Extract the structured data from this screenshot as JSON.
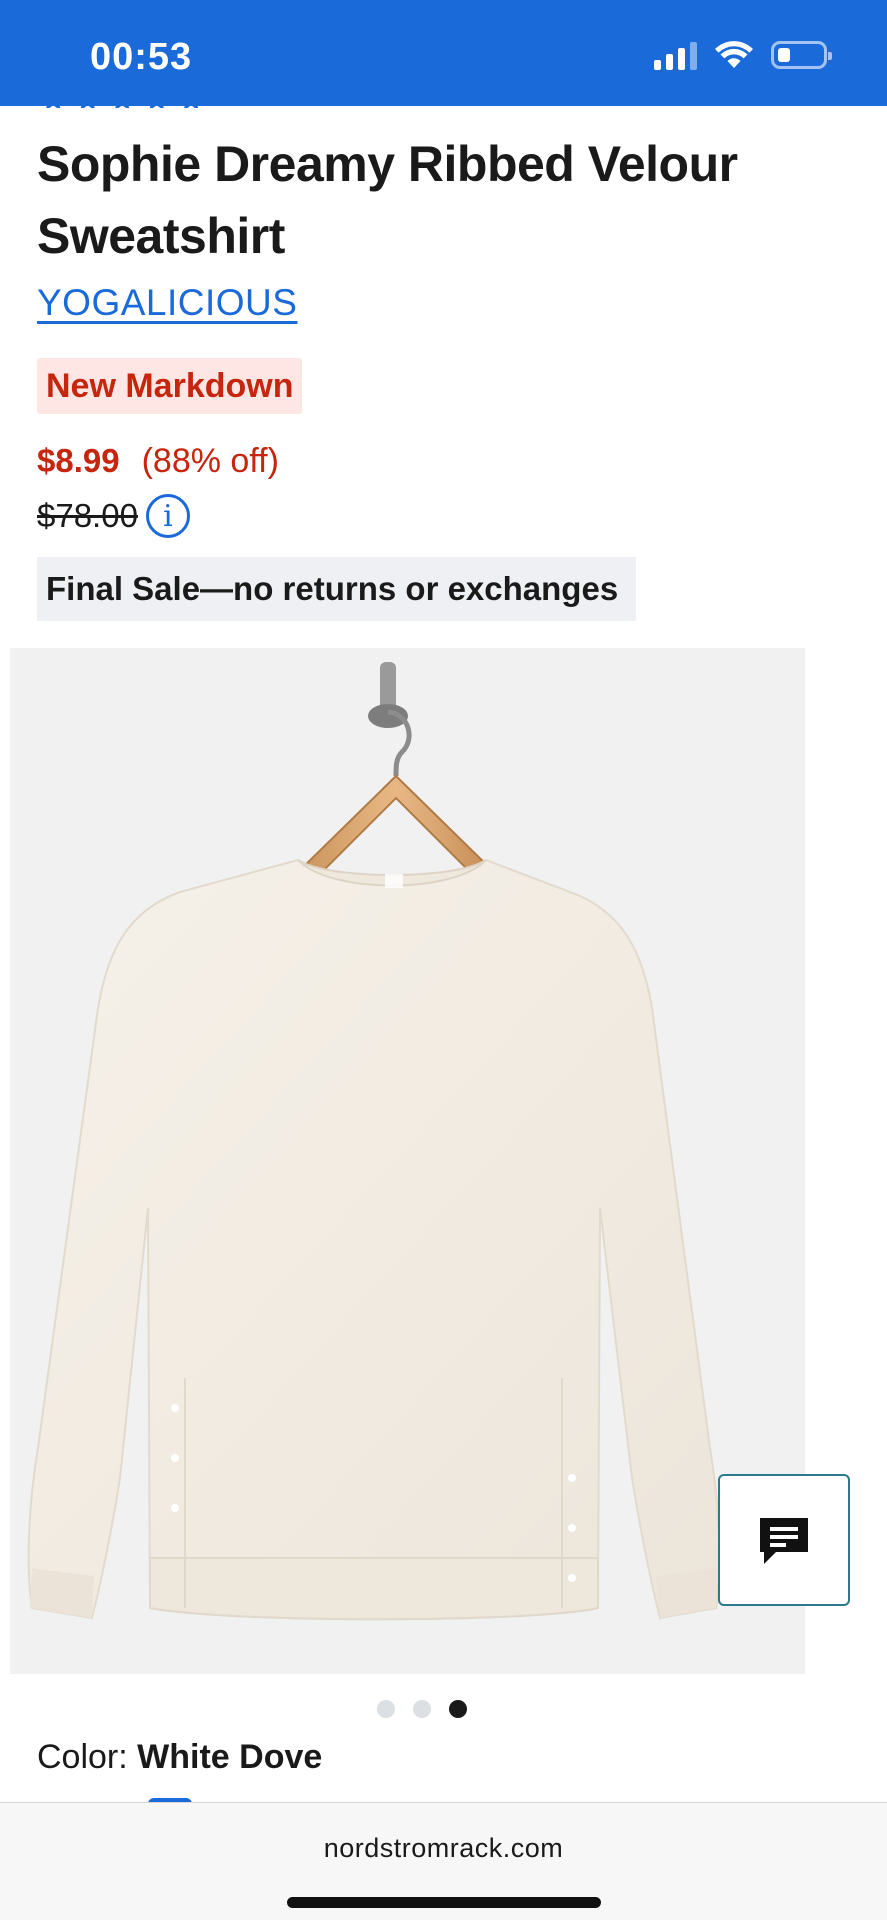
{
  "status_bar": {
    "time": "00:53",
    "icons": [
      "signal-icon",
      "wifi-icon",
      "battery-icon"
    ]
  },
  "product": {
    "title": "Sophie Dreamy Ribbed Velour Sweatshirt",
    "brand": "YOGALICIOUS",
    "badge": "New Markdown",
    "sale_price": "$8.99",
    "discount": "(88% off)",
    "original_price": "$78.00",
    "final_sale_notice": "Final Sale—no returns or exchanges",
    "color_label": "Color:",
    "color_value": "White Dove"
  },
  "gallery": {
    "image_count": 3,
    "active_index": 2
  },
  "browser": {
    "url": "nordstromrack.com"
  },
  "colors": {
    "status_bar_bg": "#1a6ad9",
    "link": "#1a6ad9",
    "sale_red": "#c6250e",
    "badge_bg": "#fde6e3",
    "notice_bg": "#eef0f3"
  }
}
